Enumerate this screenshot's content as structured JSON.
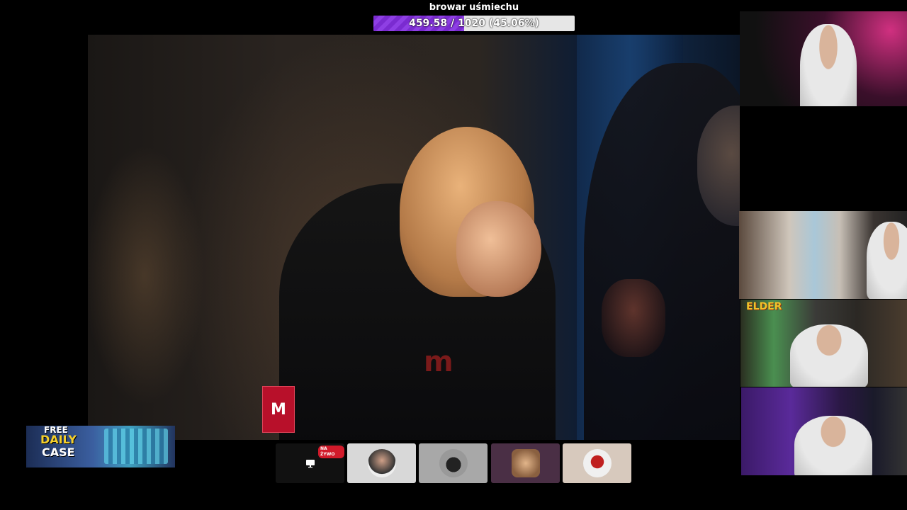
{
  "goal": {
    "title": "browar uśmiechu",
    "current": 459.58,
    "target": 1020,
    "percent": 45.06,
    "label": "459.58 / 1020 (45.06%)",
    "fill_color": "#7a2bd0"
  },
  "main_video": {
    "badge_letter": "M",
    "badge_color": "#b8102a"
  },
  "webcams": {
    "cam3_overlay": "ELDER"
  },
  "promo": {
    "line1": "FREE",
    "line2": "DAILY",
    "line3": "CASE"
  },
  "switcher": {
    "live_label": "NA ŻYWO",
    "screen_icon": "monitor-icon",
    "tiles": [
      "screen-share",
      "participant-1",
      "participant-2",
      "participant-3",
      "participant-4"
    ]
  }
}
